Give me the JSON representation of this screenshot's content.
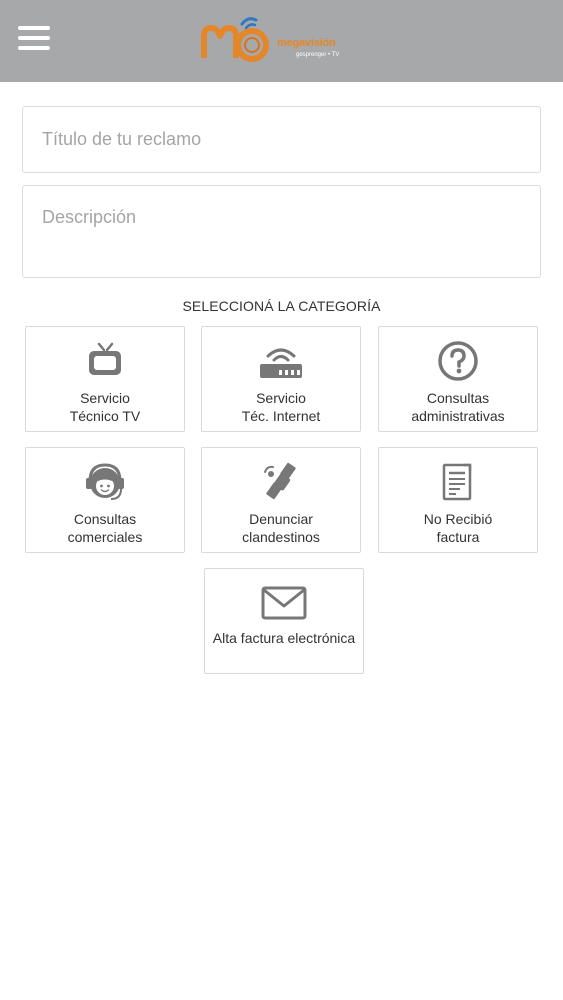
{
  "header": {
    "brand_name": "megavisión",
    "brand_tagline": "gesprenger • TV",
    "colors": {
      "bar": "#a6a8aa",
      "accent": "#e4872a",
      "accent_dark": "#d9731a",
      "mark_blue": "#2f78c4"
    }
  },
  "form": {
    "title_placeholder": "Título de tu reclamo",
    "description_placeholder": "Descripción"
  },
  "categories_title": "SELECCIONÁ LA CATEGORÍA",
  "categories": [
    {
      "icon": "tv-icon",
      "line1": "Servicio",
      "line2": "Técnico TV"
    },
    {
      "icon": "router-icon",
      "line1": "Servicio",
      "line2": "Téc. Internet"
    },
    {
      "icon": "question-icon",
      "line1": "Consultas",
      "line2": "administrativas"
    },
    {
      "icon": "headset-icon",
      "line1": "Consultas",
      "line2": "comerciales"
    },
    {
      "icon": "satellite-icon",
      "line1": "Denunciar",
      "line2": "clandestinos"
    },
    {
      "icon": "invoice-icon",
      "line1": "No Recibió",
      "line2": "factura"
    },
    {
      "icon": "envelope-icon",
      "line1": "Alta factura electrónica",
      "line2": ""
    }
  ]
}
